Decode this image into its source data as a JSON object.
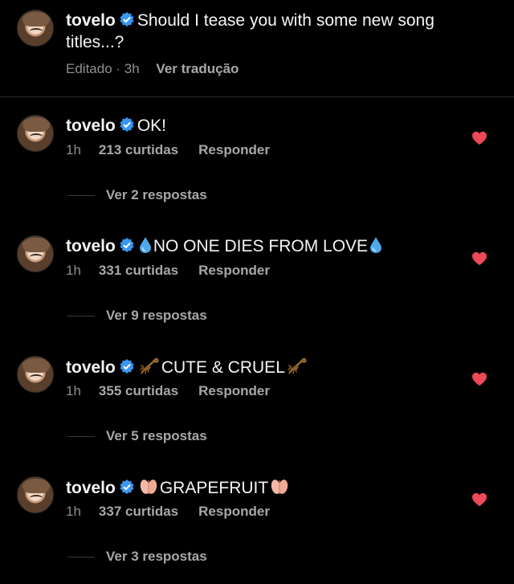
{
  "caption": {
    "username": "tovelo",
    "text": "Should I tease you with some new song titles...?",
    "edited": "Editado · 3h",
    "translate": "Ver tradução"
  },
  "comments": [
    {
      "username": "tovelo",
      "emoji_left": "",
      "text": "OK!",
      "emoji_right": "",
      "time": "1h",
      "likes": "213 curtidas",
      "reply": "Responder",
      "replies": "Ver 2 respostas"
    },
    {
      "username": "tovelo",
      "emoji_left": "droplet-icon",
      "text": "NO ONE DIES FROM LOVE",
      "emoji_right": "droplet-icon",
      "time": "1h",
      "likes": "331 curtidas",
      "reply": "Responder",
      "replies": "Ver 9 respostas"
    },
    {
      "username": "tovelo",
      "emoji_left": "scorpion-icon",
      "text": "CUTE & CRUEL",
      "emoji_right": "scorpion-icon",
      "time": "1h",
      "likes": "355 curtidas",
      "reply": "Responder",
      "replies": "Ver 5 respostas"
    },
    {
      "username": "tovelo",
      "emoji_left": "peach-icon",
      "text": "GRAPEFRUIT",
      "emoji_right": "peach-icon",
      "time": "1h",
      "likes": "337 curtidas",
      "reply": "Responder",
      "replies": "Ver 3 respostas"
    }
  ],
  "colors": {
    "background": "#000000",
    "text": "#f5f5f5",
    "muted": "#8e8e8e",
    "verified": "#3897f0",
    "heart": "#ed4956"
  }
}
